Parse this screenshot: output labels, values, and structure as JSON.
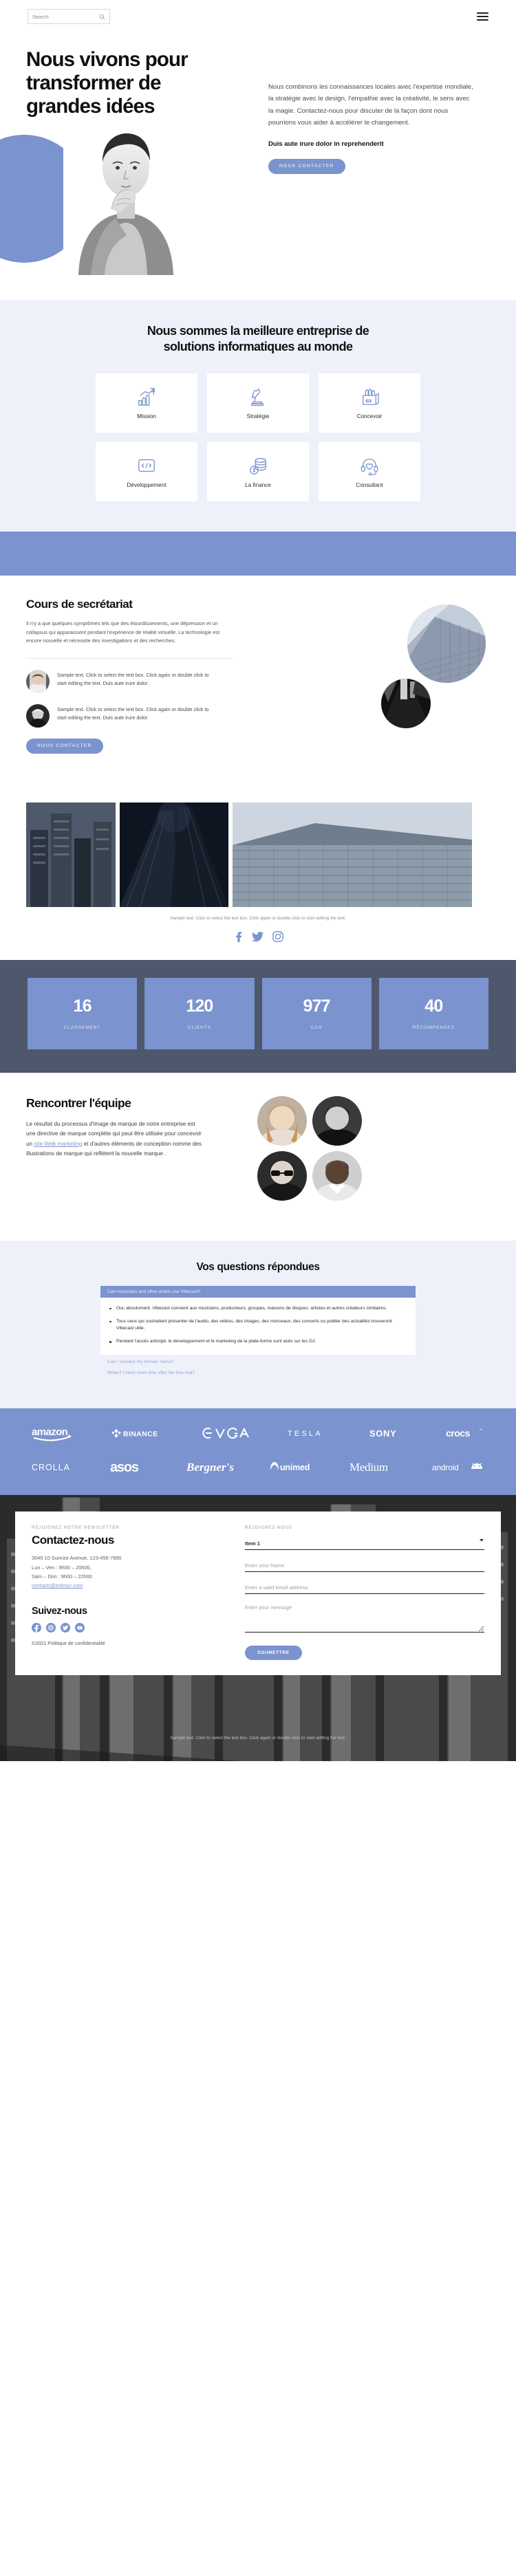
{
  "header": {
    "search_placeholder": "Search",
    "search_value": "",
    "search_icon": "search-icon",
    "menu_icon": "hamburger-menu-icon"
  },
  "hero": {
    "title": "Nous vivons pour transformer de grandes idées",
    "paragraph": "Nous combinons les connaissances locales avec l'expertise mondiale, la stratégie avec le design, l'empathie avec la créativité, le sens avec la magie. Contactez-nous pour discuter de la façon dont nous pourrions vous aider à accélérer le changement.",
    "bold_line": "Duis aute irure dolor in reprehenderit",
    "cta_label": "NOUS CONTACTER"
  },
  "services": {
    "title": "Nous sommes la meilleure entreprise de solutions informatiques au monde",
    "cards": [
      {
        "label": "Mission",
        "icon": "growth-chart-flag-icon"
      },
      {
        "label": "Stratégie",
        "icon": "chess-knight-icon"
      },
      {
        "label": "Concevoir",
        "icon": "pen-holder-icon"
      },
      {
        "label": "Développement",
        "icon": "code-brackets-icon"
      },
      {
        "label": "La finance",
        "icon": "coins-dollar-icon"
      },
      {
        "label": "Consultant",
        "icon": "headset-support-icon"
      }
    ]
  },
  "course": {
    "title": "Cours de secrétariat",
    "paragraph": "Il n'y a que quelques symptômes tels que des étourdissements, une dépression et un collapsus qui apparaissent pendant l'expérience de réalité virtuelle. La technologie est encore nouvelle et nécessite des investigations et des recherches.",
    "testimonials": [
      {
        "text": "Sample text. Click to select the text box. Click again or double click to start editing the text. Duis aute irure dolor.",
        "avatar": "avatar-person-1"
      },
      {
        "text": "Sample text. Click to select the text box. Click again or double click to start editing the text. Duis aute irure dolor.",
        "avatar": "avatar-person-2"
      }
    ],
    "cta_label": "NOUS CONTACTER"
  },
  "gallery": {
    "caption": "Sample text. Click to select the text box. Click again or double click to start editing the text.",
    "socials": [
      "facebook-icon",
      "twitter-icon",
      "instagram-icon"
    ]
  },
  "stats": [
    {
      "value": "16",
      "label": "CLASSEMENT"
    },
    {
      "value": "120",
      "label": "CLIENTS"
    },
    {
      "value": "977",
      "label": "CAS"
    },
    {
      "value": "40",
      "label": "RÉCOMPENSES"
    }
  ],
  "team": {
    "title": "Rencontrer l'équipe",
    "paragraph_before": "Le résultat du processus d'image de marque de notre entreprise est une directive de marque complète qui peut être utilisée pour concevoir un ",
    "paragraph_link": "site Web marketing",
    "paragraph_after": " et d'autres éléments de conception comme des illustrations de marque qui reflètent la nouvelle marque ."
  },
  "faq": {
    "title": "Vos questions répondues",
    "open_question": "Can musicians and other artists use Vibecast?",
    "answers": [
      "Oui, absolument. Vibecast convient aux musiciens, producteurs, groupes, maisons de disques, artistes et autres créateurs similaires.",
      "Tous ceux qui souhaitent présenter de l'audio, des vidéos, des images, des morceaux, des concerts ou publier des actualités trouveront Vibecast utile.",
      "Pendant l'accès anticipé, le développement et le marketing de la plate-forme sont axés sur les DJ."
    ],
    "questions": [
      "Can I connect my domain name?",
      "What if I need more time after the free trial?"
    ]
  },
  "brands": {
    "row1": [
      "amazon",
      "BINANCE",
      "EVGA",
      "TESLA",
      "SONY",
      "crocs"
    ],
    "row2": [
      "CROLLA",
      "asos",
      "Bergner's",
      "unimed",
      "Medium",
      "android"
    ]
  },
  "footer": {
    "eyebrow": "REJOIGNEZ NOTRE NEWSLETTER",
    "title": "Contactez-nous",
    "address_line1": "3045 10 Sunrize Avenue, 123-456-7890",
    "address_line2": "Lun – Ven : 9h00 – 20h00,",
    "address_line3": "Sam – Dim : 9h00 – 22h00",
    "email": "contacts@esbnyc.com",
    "follow_title": "Suivez-nous",
    "socials": [
      "facebook-icon",
      "instagram-icon",
      "twitter-icon",
      "youtube-icon"
    ],
    "copyright": "©2021 Politique de confidentialité",
    "form": {
      "eyebrow": "REJOIGNEZ-NOUS",
      "select_value": "Item 1",
      "select_options": [
        "Item 1"
      ],
      "name_placeholder": "Enter your Name",
      "email_placeholder": "Enter a valid email address",
      "message_placeholder": "Enter your message",
      "submit_label": "SOUMETTRE"
    },
    "bottom_note": "Sample text. Click to select the text box. Click again or double click to start editing the text."
  },
  "colors": {
    "accent": "#7b93ce",
    "light_bg": "#eef1fa",
    "slate": "#4e576b",
    "dark": "#2e2e2e"
  }
}
